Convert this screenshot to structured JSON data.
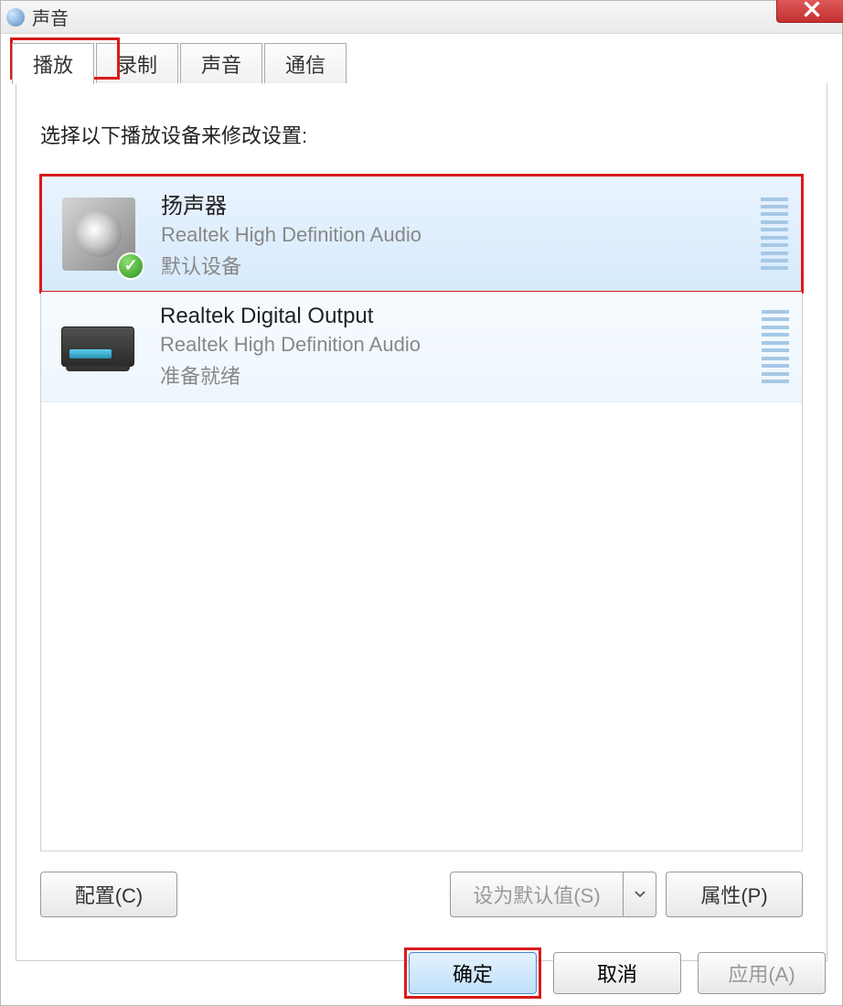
{
  "window": {
    "title": "声音"
  },
  "tabs": [
    {
      "label": "播放"
    },
    {
      "label": "录制"
    },
    {
      "label": "声音"
    },
    {
      "label": "通信"
    }
  ],
  "prompt": "选择以下播放设备来修改设置:",
  "devices": [
    {
      "name": "扬声器",
      "driver": "Realtek High Definition Audio",
      "status": "默认设备"
    },
    {
      "name": "Realtek Digital Output",
      "driver": "Realtek High Definition Audio",
      "status": "准备就绪"
    }
  ],
  "buttons": {
    "configure": "配置(C)",
    "setDefault": "设为默认值(S)",
    "properties": "属性(P)",
    "ok": "确定",
    "cancel": "取消",
    "apply": "应用(A)"
  }
}
